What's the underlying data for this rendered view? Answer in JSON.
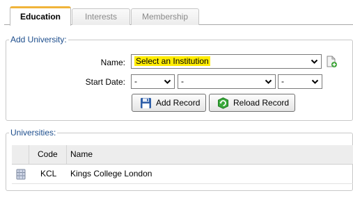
{
  "tabs": [
    {
      "label": "Education",
      "active": true
    },
    {
      "label": "Interests",
      "active": false
    },
    {
      "label": "Membership",
      "active": false
    }
  ],
  "add_university": {
    "legend": "Add University:",
    "name_label": "Name:",
    "name_value": "Select an Institution",
    "start_date_label": "Start Date:",
    "day_value": "-",
    "month_value": "-",
    "year_value": "-",
    "add_button": "Add Record",
    "reload_button": "Reload Record"
  },
  "universities": {
    "legend": "Universities:",
    "columns": [
      "Code",
      "Name"
    ],
    "rows": [
      {
        "code": "KCL",
        "name": "Kings College London"
      }
    ]
  },
  "colors": {
    "legend_text": "#1c4d8c",
    "active_tab_accent": "#f0b43a",
    "highlight": "#ffec00"
  },
  "icons": [
    "add-document-icon",
    "chevron-down-icon",
    "save-disk-icon",
    "reload-icon",
    "database-icon"
  ]
}
